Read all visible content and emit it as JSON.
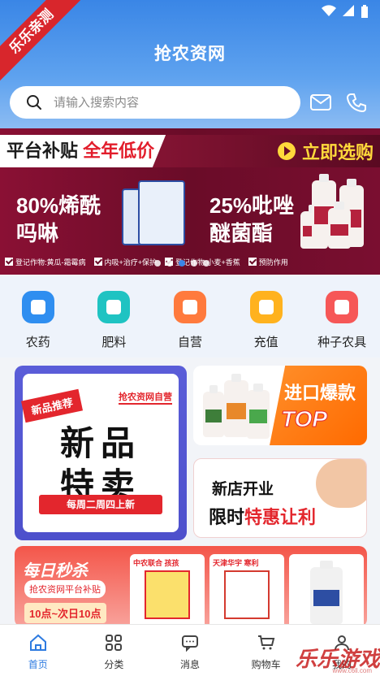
{
  "corner_ribbon": "乐乐亲测",
  "header": {
    "title": "抢农资网",
    "search_placeholder": "请输入搜索内容"
  },
  "banner": {
    "left_pill_part1": "平台补贴",
    "left_pill_part2": "全年低价",
    "select_now": "立即选购",
    "product1": "80%烯酰吗啉",
    "product2": "25%吡唑醚菌酯",
    "foot": [
      "登记作物:黄瓜-霜霉病",
      "内吸+治疗+保护",
      "登记作物:小麦+香蕉",
      "预防作用"
    ]
  },
  "categories": [
    {
      "label": "农药",
      "color": "#2f8ef0"
    },
    {
      "label": "肥料",
      "color": "#1fc3c2"
    },
    {
      "label": "自营",
      "color": "#ff7a3d"
    },
    {
      "label": "充值",
      "color": "#ffb21e"
    },
    {
      "label": "种子农具",
      "color": "#f65757"
    }
  ],
  "promo": {
    "new_tag": "新品推荐",
    "self_tag": "抢农资网自营",
    "new_big1": "新品",
    "new_big2": "特卖",
    "new_strip": "每周二周四上新",
    "import_line1": "进口爆款",
    "import_line2": "TOP",
    "shop_line1": "新店开业",
    "shop_line2a": "限时",
    "shop_line2b": "特惠让利",
    "flash_title": "每日秒杀",
    "flash_sub": "抢农资网平台补贴",
    "flash_time": "10点~次日10点",
    "flash_items": [
      "中农联合 孩孩",
      "天津华宇 寒利",
      ""
    ]
  },
  "tabs": [
    {
      "label": "首页"
    },
    {
      "label": "分类"
    },
    {
      "label": "消息"
    },
    {
      "label": "购物车"
    },
    {
      "label": "我的"
    }
  ],
  "watermark": "乐乐游戏",
  "watermark_sub": "www.c6ll.com"
}
